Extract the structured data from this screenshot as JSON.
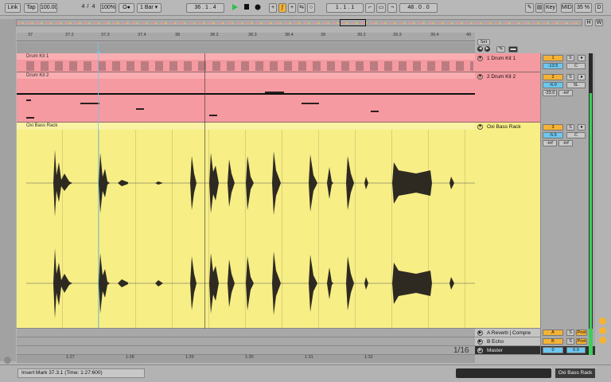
{
  "transport": {
    "link": "Link",
    "tap": "Tap",
    "tempo": "100.00",
    "sig_num": "4",
    "sig_den": "4",
    "zoom": "100%",
    "metro": "O●",
    "quant": "1 Bar",
    "pos_bar": "36",
    "pos_beat": "1",
    "pos_six": "4",
    "loop_start": "1 . 1 . 1",
    "loop_len": "48 . 0 . 0",
    "key": "Key",
    "midi": "MIDI",
    "cpu": "35 %",
    "d": "D"
  },
  "overview": {
    "h": "H",
    "w": "W"
  },
  "ruler": {
    "marks": [
      "37",
      "37.2",
      "37.3",
      "37.4",
      "38",
      "38.2",
      "38.3",
      "38.4",
      "39",
      "39.2",
      "39.3",
      "39.4",
      "40"
    ],
    "set_label": "Set"
  },
  "tracks": [
    {
      "clip_title": "Drum Kit 1",
      "name": "1 Drum Kit 1",
      "num": "1",
      "s": "S",
      "vol": "-13.5",
      "pan": "C"
    },
    {
      "clip_title": "Drum Kit 2",
      "name": "2 Drum Kit 2",
      "num": "2",
      "s": "S",
      "vol": "-6.0",
      "pan": "5L",
      "send_a": "-33.0",
      "send_b": "-inf"
    },
    {
      "clip_title": "Oxi Bass Rack",
      "name": "Oxi Bass Rack",
      "num": "3",
      "s": "S",
      "vol": "-5.5",
      "pan": "C",
      "send_a": "-inf",
      "send_b": "-inf"
    }
  ],
  "returns": [
    {
      "name": "A Reverb | Compre",
      "num": "A",
      "s": "S",
      "post": "Post"
    },
    {
      "name": "B Echo",
      "num": "B",
      "s": "S",
      "post": "Post"
    }
  ],
  "master": {
    "name": "Master",
    "vol": "0",
    "pan": "6.0",
    "post": "Post"
  },
  "grid_fraction": "1/16",
  "time_ruler": [
    "1:27",
    "1:28",
    "1:29",
    "1:30",
    "1:31",
    "1:32"
  ],
  "status": {
    "text": "Insert Mark 37.3.1 (Time: 1:27:600)",
    "track_label": "Oxi Bass Rack"
  },
  "colors": {
    "drum_lane": "#f59aa0",
    "bass_lane": "#f7ee86",
    "accent_orange": "#f5b234",
    "accent_blue": "#6cc7ef"
  }
}
